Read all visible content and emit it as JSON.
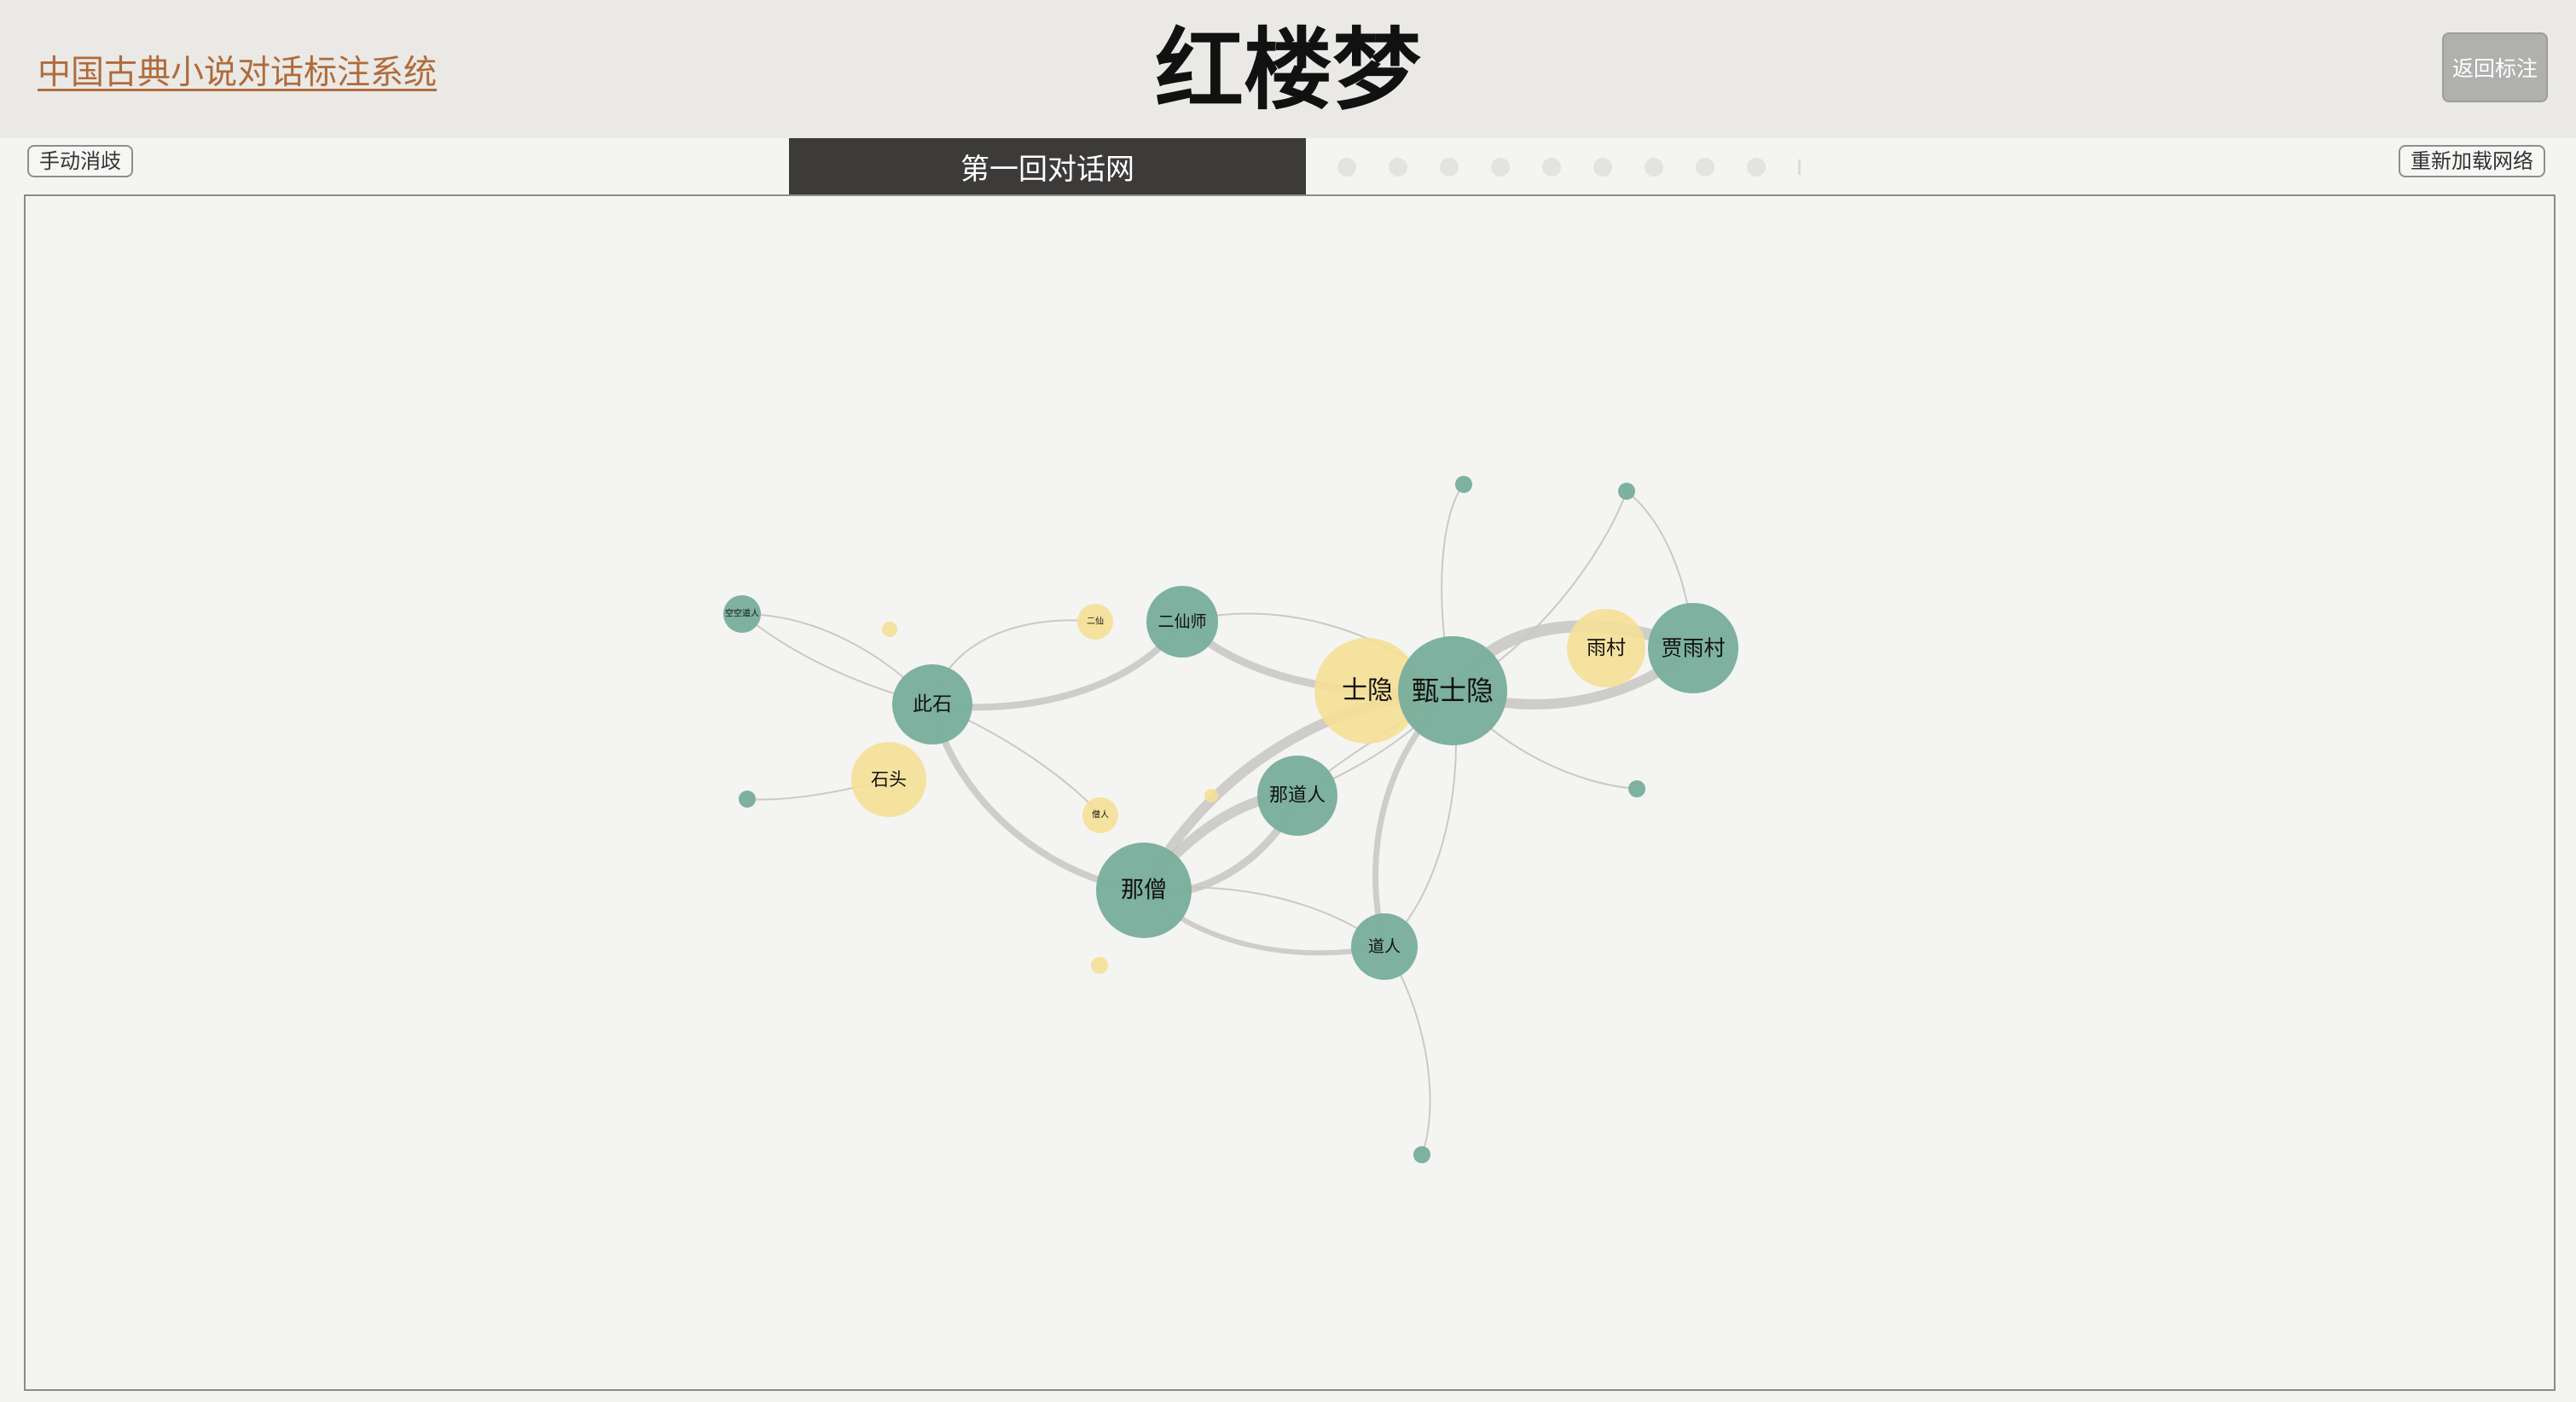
{
  "header": {
    "home_link": "中国古典小说对话标注系统",
    "title": "红楼梦",
    "back_button": "返回标注"
  },
  "toolbar": {
    "manual_button": "手动消歧",
    "reload_button": "重新加载网络",
    "chapter_title": "第一回对话网",
    "chapter_dot_count": 9
  },
  "colors": {
    "character_node": "#7aae9c",
    "alias_node": "#f5df98",
    "edge": "#c8c6c3",
    "chapter_bar": "#3c3b3a",
    "link": "#b06b3c"
  },
  "network": {
    "nodes": [
      {
        "id": "zhenshiyin",
        "label": "甄士隐",
        "type": "character"
      },
      {
        "id": "shiyin",
        "label": "士隐",
        "type": "alias"
      },
      {
        "id": "jiayucun",
        "label": "贾雨村",
        "type": "character"
      },
      {
        "id": "yucun",
        "label": "雨村",
        "type": "alias"
      },
      {
        "id": "naseng",
        "label": "那僧",
        "type": "character"
      },
      {
        "id": "cishi",
        "label": "此石",
        "type": "character"
      },
      {
        "id": "shitou",
        "label": "石头",
        "type": "alias"
      },
      {
        "id": "erxianshi",
        "label": "二仙师",
        "type": "character"
      },
      {
        "id": "erxian",
        "label": "二仙",
        "type": "alias"
      },
      {
        "id": "nadaoren",
        "label": "那道人",
        "type": "character"
      },
      {
        "id": "daoren",
        "label": "道人",
        "type": "character"
      },
      {
        "id": "kongkong",
        "label": "空空道人",
        "type": "character"
      },
      {
        "id": "sengren",
        "label": "僧人",
        "type": "alias"
      },
      {
        "id": "small_top1",
        "label": "",
        "type": "character"
      },
      {
        "id": "small_top2",
        "label": "",
        "type": "character"
      },
      {
        "id": "small_right",
        "label": "",
        "type": "character"
      },
      {
        "id": "small_left",
        "label": "",
        "type": "character"
      },
      {
        "id": "small_bottom",
        "label": "",
        "type": "character"
      },
      {
        "id": "tiny_y1",
        "label": "",
        "type": "alias"
      },
      {
        "id": "tiny_y2",
        "label": "",
        "type": "alias"
      },
      {
        "id": "tiny_y3",
        "label": "",
        "type": "alias"
      }
    ],
    "edges": [
      {
        "source": "zhenshiyin",
        "target": "jiayucun",
        "weight": 5
      },
      {
        "source": "zhenshiyin",
        "target": "naseng",
        "weight": 4
      },
      {
        "source": "zhenshiyin",
        "target": "daoren",
        "weight": 3
      },
      {
        "source": "zhenshiyin",
        "target": "erxianshi",
        "weight": 3
      },
      {
        "source": "naseng",
        "target": "nadaoren",
        "weight": 4
      },
      {
        "source": "naseng",
        "target": "cishi",
        "weight": 3
      },
      {
        "source": "naseng",
        "target": "daoren",
        "weight": 3
      },
      {
        "source": "cishi",
        "target": "erxianshi",
        "weight": 2
      },
      {
        "source": "cishi",
        "target": "kongkong",
        "weight": 1
      },
      {
        "source": "cishi",
        "target": "naseng",
        "weight": 1
      },
      {
        "source": "jiayucun",
        "target": "small_top2",
        "weight": 1
      },
      {
        "source": "zhenshiyin",
        "target": "small_top1",
        "weight": 1
      },
      {
        "source": "zhenshiyin",
        "target": "small_right",
        "weight": 1
      },
      {
        "source": "daoren",
        "target": "small_bottom",
        "weight": 1
      }
    ]
  }
}
